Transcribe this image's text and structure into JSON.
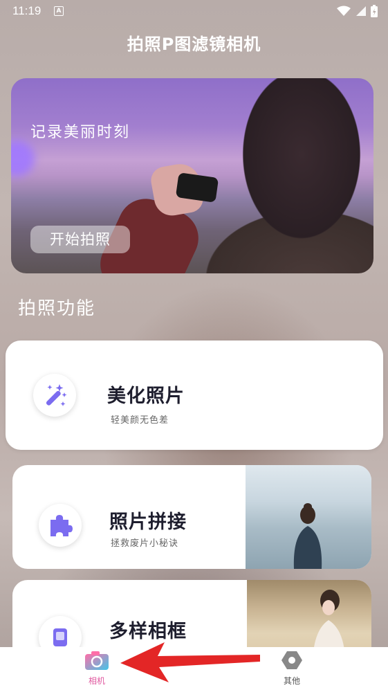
{
  "status_bar": {
    "time": "11:19",
    "notification_badge": "A"
  },
  "page_title": "拍照P图滤镜相机",
  "hero": {
    "caption": "记录美丽时刻",
    "button_label": "开始拍照"
  },
  "section_title": "拍照功能",
  "features": [
    {
      "title": "美化照片",
      "subtitle": "轻美颜无色差",
      "icon": "magic-wand-icon"
    },
    {
      "title": "照片拼接",
      "subtitle": "拯救废片小秘诀",
      "icon": "puzzle-icon"
    },
    {
      "title": "多样相框",
      "subtitle": "",
      "icon": "frame-icon"
    }
  ],
  "tabs": [
    {
      "label": "相机",
      "icon": "camera-icon",
      "active": true,
      "color": "#e05aa0"
    },
    {
      "label": "其他",
      "icon": "hexagon-icon",
      "active": false,
      "color": "#555555"
    }
  ],
  "colors": {
    "accent": "#7b6cf0",
    "arrow": "#e32626"
  }
}
